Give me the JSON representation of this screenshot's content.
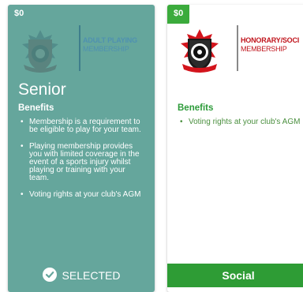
{
  "cards": [
    {
      "price": "$0",
      "banner_title": "ADULT PLAYING",
      "banner_subtitle": "MEMBERSHIP",
      "name": "Senior",
      "benefits_heading": "Benefits",
      "benefits": [
        "Membership is a requirement to be eligible to play for your team.",
        "Playing membership provides you with limited coverage in the event of a sports injury whilst playing or training with your team.",
        "Voting rights at your club's AGM"
      ],
      "action_label": "SELECTED",
      "state": "selected",
      "accent_color": "#65a69c"
    },
    {
      "price": "$0",
      "banner_title": "HONORARY/SOCI",
      "banner_subtitle": "MEMBERSHIP",
      "name": "",
      "benefits_heading": "Benefits",
      "benefits": [
        "Voting rights at your club's AGM"
      ],
      "action_label": "Social",
      "state": "available",
      "accent_color": "#2e9c35"
    }
  ],
  "colors": {
    "selected_card_bg": "#65a69c",
    "price_badge": "#3bab3c",
    "social_button": "#2e9c35",
    "crest_red": "#c0141c"
  },
  "icons": {
    "crest": "club-crest-icon",
    "check": "check-circle-icon"
  }
}
